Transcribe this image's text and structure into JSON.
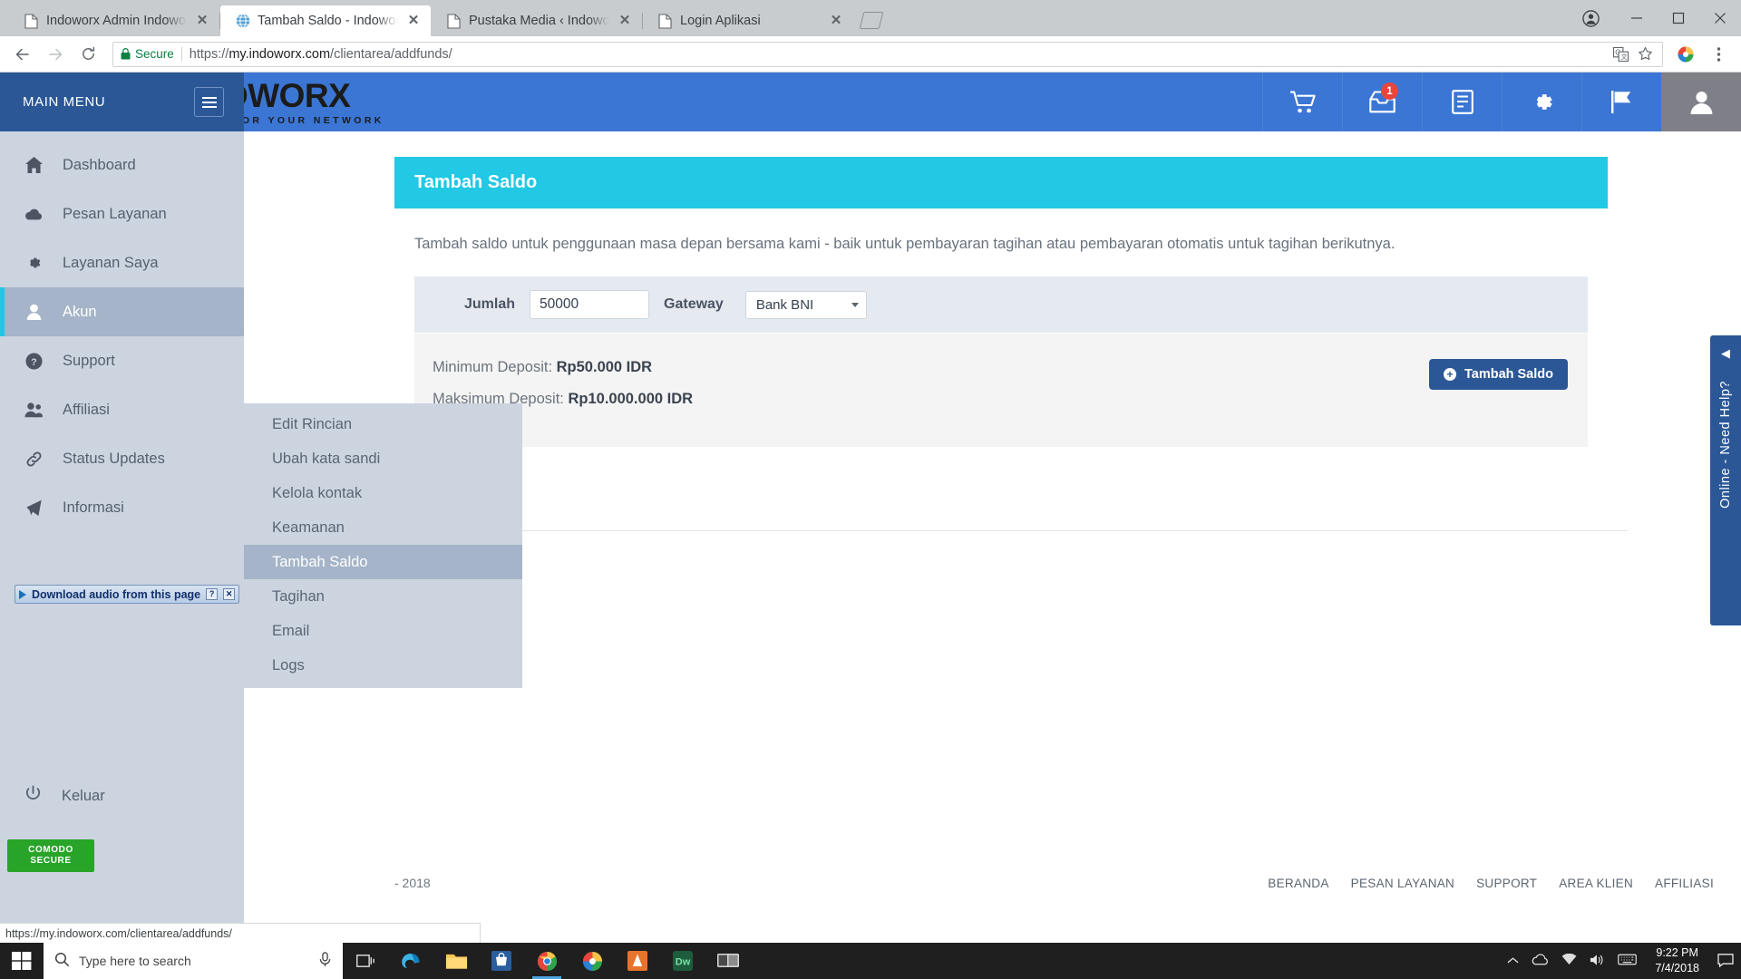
{
  "browser": {
    "tabs": [
      {
        "title": "Indoworx Admin Indoworx",
        "favicon": "page-icon",
        "active": false
      },
      {
        "title": "Tambah Saldo - Indoworx",
        "favicon": "globe-icon",
        "active": true
      },
      {
        "title": "Pustaka Media ‹ Indoworx",
        "favicon": "page-icon",
        "active": false
      },
      {
        "title": "Login Aplikasi",
        "favicon": "page-icon",
        "active": false
      }
    ],
    "new_tab_label": "+",
    "window_controls": {
      "profile": "profile-icon",
      "minimize": "minimize-icon",
      "maximize": "maximize-icon",
      "close": "close-icon"
    },
    "toolbar": {
      "back": "back-arrow-icon",
      "forward": "forward-arrow-icon",
      "reload": "reload-icon",
      "security_label": "Secure",
      "url_prefix": "https://",
      "url_host": "my.indoworx.com",
      "url_path": "/clientarea/addfunds/",
      "translate": "translate-icon",
      "bookmark": "star-icon",
      "idm": "idm-extension-icon",
      "menu": "three-dot-menu-icon"
    },
    "status_bubble": "https://my.indoworx.com/clientarea/addfunds/"
  },
  "sidebar": {
    "header_label": "MAIN MENU",
    "toggle": "hamburger-icon",
    "items": [
      {
        "label": "Dashboard",
        "icon": "home-icon",
        "active": false
      },
      {
        "label": "Pesan Layanan",
        "icon": "cloud-icon",
        "active": false
      },
      {
        "label": "Layanan Saya",
        "icon": "gear-icon",
        "active": false
      },
      {
        "label": "Akun",
        "icon": "user-icon",
        "active": true
      },
      {
        "label": "Support",
        "icon": "help-circle-icon",
        "active": false
      },
      {
        "label": "Affiliasi",
        "icon": "users-icon",
        "active": false
      },
      {
        "label": "Status Updates",
        "icon": "link-icon",
        "active": false
      },
      {
        "label": "Informasi",
        "icon": "megaphone-icon",
        "active": false
      }
    ],
    "logout": {
      "label": "Keluar",
      "icon": "power-icon"
    }
  },
  "submenu": {
    "items": [
      {
        "label": "Edit Rincian",
        "active": false
      },
      {
        "label": "Ubah kata sandi",
        "active": false
      },
      {
        "label": "Kelola kontak",
        "active": false
      },
      {
        "label": "Keamanan",
        "active": false
      },
      {
        "label": "Tambah Saldo",
        "active": true
      },
      {
        "label": "Tagihan",
        "active": false
      },
      {
        "label": "Email",
        "active": false
      },
      {
        "label": "Logs",
        "active": false
      }
    ]
  },
  "topbar": {
    "logo_main": "DWORX",
    "logo_tagline": "FOR YOUR NETWORK",
    "icons": [
      {
        "name": "cart-icon",
        "badge": ""
      },
      {
        "name": "inbox-icon",
        "badge": "1"
      },
      {
        "name": "invoice-icon",
        "badge": ""
      },
      {
        "name": "gear-icon",
        "badge": ""
      },
      {
        "name": "flag-icon",
        "badge": ""
      },
      {
        "name": "account-icon",
        "badge": ""
      }
    ]
  },
  "main": {
    "panel_title": "Tambah Saldo",
    "lead": "Tambah saldo untuk penggunaan masa depan bersama kami - baik untuk pembayaran tagihan atau pembayaran otomatis untuk tagihan berikutnya.",
    "form": {
      "amount_label": "Jumlah",
      "amount_value": "50000",
      "amount_placeholder": "",
      "gateway_label": "Gateway",
      "gateway_selected": "Bank BNI",
      "gateway_caret": "chevron-down-icon"
    },
    "deposit": {
      "min_label": "Minimum Deposit:",
      "min_value": "Rp50.000 IDR",
      "max_label": "Maksimum Deposit:",
      "max_value": "Rp10.000.000 IDR"
    },
    "submit_button": {
      "label": "Tambah  Saldo",
      "icon": "plus-circle-icon"
    }
  },
  "needhelp": {
    "arrow": "◀",
    "text": "Online - Need Help?"
  },
  "idm_bar": {
    "label": "Download audio from this page",
    "help": "?",
    "close": "✕"
  },
  "comodo": {
    "line1": "COMODO",
    "line2": "SECURE"
  },
  "footer": {
    "copyright": "- 2018",
    "links": [
      "BERANDA",
      "PESAN LAYANAN",
      "SUPPORT",
      "AREA KLIEN",
      "AFFILIASI"
    ]
  },
  "taskbar": {
    "start": "windows-start-icon",
    "search_placeholder": "Type here to search",
    "mic": "microphone-icon",
    "taskview": "task-view-icon",
    "apps": [
      {
        "name": "edge-icon"
      },
      {
        "name": "file-explorer-icon"
      },
      {
        "name": "microsoft-store-icon"
      },
      {
        "name": "chrome-icon"
      },
      {
        "name": "idm-icon"
      },
      {
        "name": "vlc-icon"
      },
      {
        "name": "dreamweaver-icon"
      },
      {
        "name": "filezilla-icon"
      }
    ],
    "tray": {
      "chevron": "show-hidden-icons",
      "onedrive": "onedrive-icon",
      "network": "wifi-icon",
      "volume": "volume-icon",
      "keyboard": "keyboard-icon",
      "time": "9:22 PM",
      "date": "7/4/2018",
      "notifications": "action-center-icon"
    }
  }
}
